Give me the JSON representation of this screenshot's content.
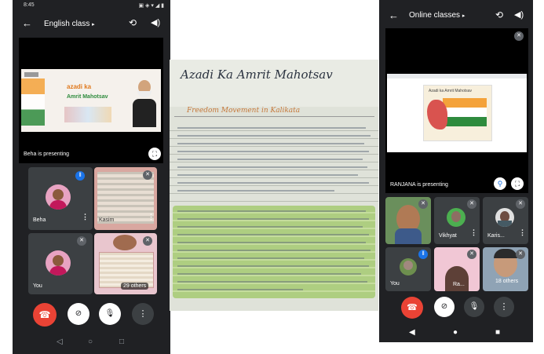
{
  "left_phone": {
    "status_time": "8:45",
    "meeting_title": "English class",
    "presenter_label": "Beha is presenting",
    "slide_text_top": "azadi ka",
    "slide_text_bottom": "Amrit Mahotsav",
    "participants": [
      {
        "name": "Beha"
      },
      {
        "name": "Kasim"
      },
      {
        "name": "You"
      },
      {
        "name": "29 others"
      }
    ]
  },
  "center_photo": {
    "heading": "Azadi Ka Amrit Mahotsav",
    "subheading": "Freedom Movement in Kalikata"
  },
  "right_phone": {
    "meeting_title": "Online classes",
    "presenter_label": "RANJANA is presenting",
    "slide_title": "Azadi ka Amrit Mahotsav",
    "participants": [
      {
        "name": ""
      },
      {
        "name": "Vikhyat"
      },
      {
        "name": "Karis..."
      },
      {
        "name": "You"
      },
      {
        "name": "Ra..."
      },
      {
        "name": "18 others"
      }
    ]
  },
  "colors": {
    "phone_bg": "#202124",
    "tile_bg": "#3c4043",
    "end_call": "#ea4335",
    "accent_blue": "#8ab4f8",
    "saffron": "#f4a23a",
    "green": "#2e8b3d"
  },
  "icons": [
    "back-arrow-icon",
    "dropdown-icon",
    "switch-camera-icon",
    "speaker-icon",
    "fullscreen-icon",
    "mic-off-icon",
    "more-icon",
    "end-call-icon",
    "camera-off-icon",
    "pin-icon",
    "mic-icon"
  ]
}
